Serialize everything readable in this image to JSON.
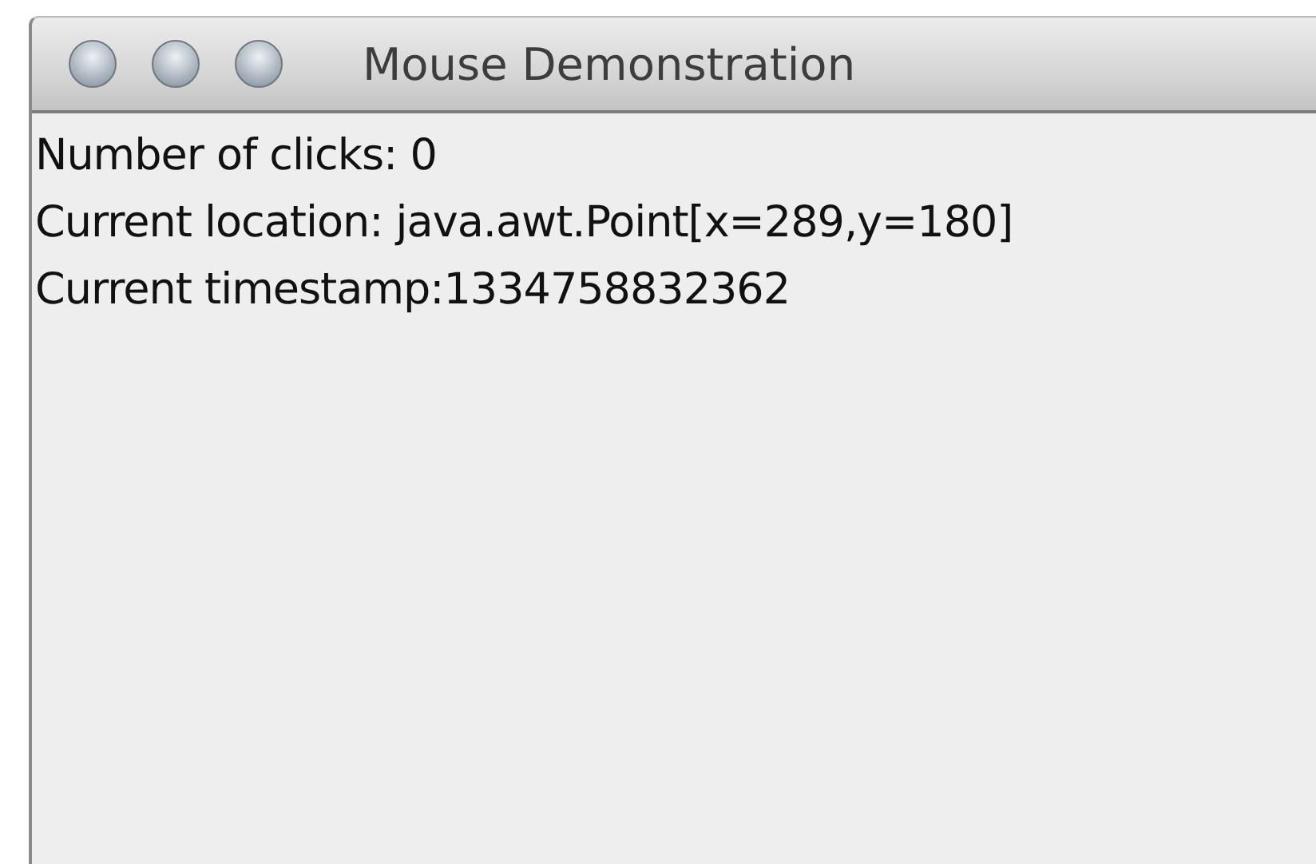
{
  "window": {
    "title": "Mouse Demonstration"
  },
  "lines": [
    "Number of clicks: 0",
    "Current location: java.awt.Point[x=289,y=180]",
    "Current timestamp:1334758832362"
  ]
}
